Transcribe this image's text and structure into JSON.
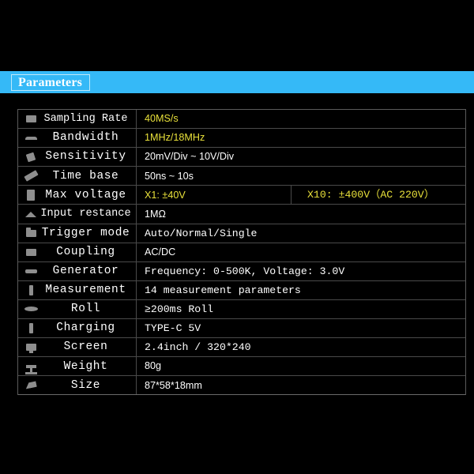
{
  "header": {
    "title": "Parameters",
    "band_color": "#35b9f7",
    "box_border_color": "#bfe9fb"
  },
  "colors": {
    "background": "#000000",
    "highlight_text": "#e8e03a",
    "body_text": "#ffffff",
    "grid_line": "#4a4a4a",
    "icon_gray": "#8e8e8e"
  },
  "table": {
    "rows": [
      {
        "icon": "screen-rect-icon",
        "label": "Sampling Rate",
        "value": "40MS/s",
        "value_style": "sans yellow"
      },
      {
        "icon": "bar-icon",
        "label": "Bandwidth",
        "value": "1MHz/18MHz",
        "value_style": "sans yellow"
      },
      {
        "icon": "tilt-square-icon",
        "label": "Sensitivity",
        "value": "20mV/Div ~ 10V/Div",
        "value_style": "sans"
      },
      {
        "icon": "slash-icon",
        "label": "Time base",
        "value": "50ns ~ 10s",
        "value_style": "sans"
      },
      {
        "icon": "vert-block-icon",
        "label": "Max voltage",
        "value": "X1: ±40V",
        "value_style": "sans yellow",
        "value2": "X10: ±400V（AC 220V）",
        "value2_style": "mono yellow"
      },
      {
        "icon": "dome-icon",
        "label": "Input restance",
        "value": "1MΩ",
        "value_style": "sans"
      },
      {
        "icon": "folder-icon",
        "label": "Trigger mode",
        "value": "Auto/Normal/Single",
        "value_style": "mono"
      },
      {
        "icon": "screen-rect-icon",
        "label": "Coupling",
        "value": "AC/DC",
        "value_style": "sans"
      },
      {
        "icon": "dash-icon",
        "label": "Generator",
        "value": "Frequency: 0-500K, Voltage: 3.0V",
        "value_style": "mono"
      },
      {
        "icon": "thin-block-icon",
        "label": "Measurement",
        "value": "14 measurement parameters",
        "value_style": "mono"
      },
      {
        "icon": "ellipse-icon",
        "label": "Roll",
        "value": "≥200ms Roll",
        "value_style": "mono"
      },
      {
        "icon": "thin-block-icon",
        "label": "Charging",
        "value": "TYPE-C 5V",
        "value_style": "mono"
      },
      {
        "icon": "monitor-icon",
        "label": "Screen",
        "value": "2.4inch / 320*240",
        "value_style": "mono"
      },
      {
        "icon": "scale-icon",
        "label": "Weight",
        "value": "80g",
        "value_style": "sans"
      },
      {
        "icon": "ruler-icon",
        "label": "Size",
        "value": "87*58*18mm",
        "value_style": "sans"
      }
    ]
  }
}
